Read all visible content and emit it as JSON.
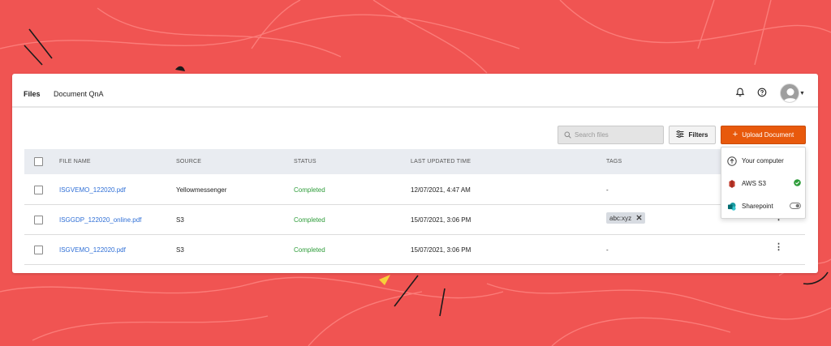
{
  "tabs": [
    {
      "label": "Files",
      "active": true
    },
    {
      "label": "Document QnA",
      "active": false
    }
  ],
  "header_icons": [
    "bell-icon",
    "help-icon",
    "avatar"
  ],
  "search": {
    "placeholder": "Search files",
    "value": ""
  },
  "filters_label": "Filters",
  "upload_label": "Upload Document",
  "columns": [
    "FILE NAME",
    "SOURCE",
    "STATUS",
    "LAST UPDATED TIME",
    "TAGS"
  ],
  "rows": [
    {
      "file": "ISGVEMO_122020.pdf",
      "source": "Yellowmessenger",
      "status": "Completed",
      "updated": "12/07/2021, 4:47 AM",
      "tags": "-"
    },
    {
      "file": "ISGGDP_122020_online.pdf",
      "source": "S3",
      "status": "Completed",
      "updated": "15/07/2021, 3:06 PM",
      "tag_chip": "abc:xyz"
    },
    {
      "file": "ISGVEMO_122020.pdf",
      "source": "S3",
      "status": "Completed",
      "updated": "15/07/2021, 3:06 PM",
      "tags": "-"
    }
  ],
  "upload_menu": [
    {
      "label": "Your computer",
      "icon": "cloud-upload-icon"
    },
    {
      "label": "AWS S3",
      "icon": "aws-s3-icon",
      "connected": true
    },
    {
      "label": "Sharepoint",
      "icon": "sharepoint-icon",
      "toggle": false
    }
  ],
  "colors": {
    "background": "#f05452",
    "accent": "#e8590c",
    "link": "#2f6fd6",
    "status_ok": "#2e9c3a"
  }
}
